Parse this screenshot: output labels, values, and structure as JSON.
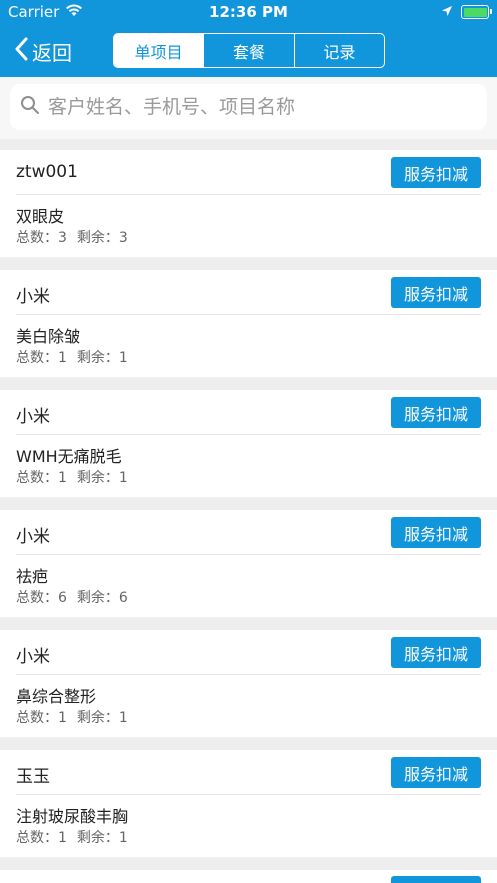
{
  "status_bar": {
    "carrier": "Carrier",
    "time": "12:36 PM"
  },
  "nav": {
    "back_label": "返回",
    "tabs": [
      {
        "label": "单项目",
        "active": true
      },
      {
        "label": "套餐",
        "active": false
      },
      {
        "label": "记录",
        "active": false
      }
    ]
  },
  "search": {
    "placeholder": "客户姓名、手机号、项目名称",
    "value": ""
  },
  "colors": {
    "primary": "#1296db",
    "battery": "#4cd964"
  },
  "labels": {
    "total": "总数：",
    "remaining": "剩余："
  },
  "items": [
    {
      "customer": "ztw001",
      "project": "双眼皮",
      "total": "3",
      "remaining": "3",
      "action": "服务扣减"
    },
    {
      "customer": "小米",
      "project": "美白除皱",
      "total": "1",
      "remaining": "1",
      "action": "服务扣减"
    },
    {
      "customer": "小米",
      "project": "WMH无痛脱毛",
      "total": "1",
      "remaining": "1",
      "action": "服务扣减"
    },
    {
      "customer": "小米",
      "project": "祛疤",
      "total": "6",
      "remaining": "6",
      "action": "服务扣减"
    },
    {
      "customer": "小米",
      "project": "鼻综合整形",
      "total": "1",
      "remaining": "1",
      "action": "服务扣减"
    },
    {
      "customer": "玉玉",
      "project": "注射玻尿酸丰胸",
      "total": "1",
      "remaining": "1",
      "action": "服务扣减"
    }
  ]
}
